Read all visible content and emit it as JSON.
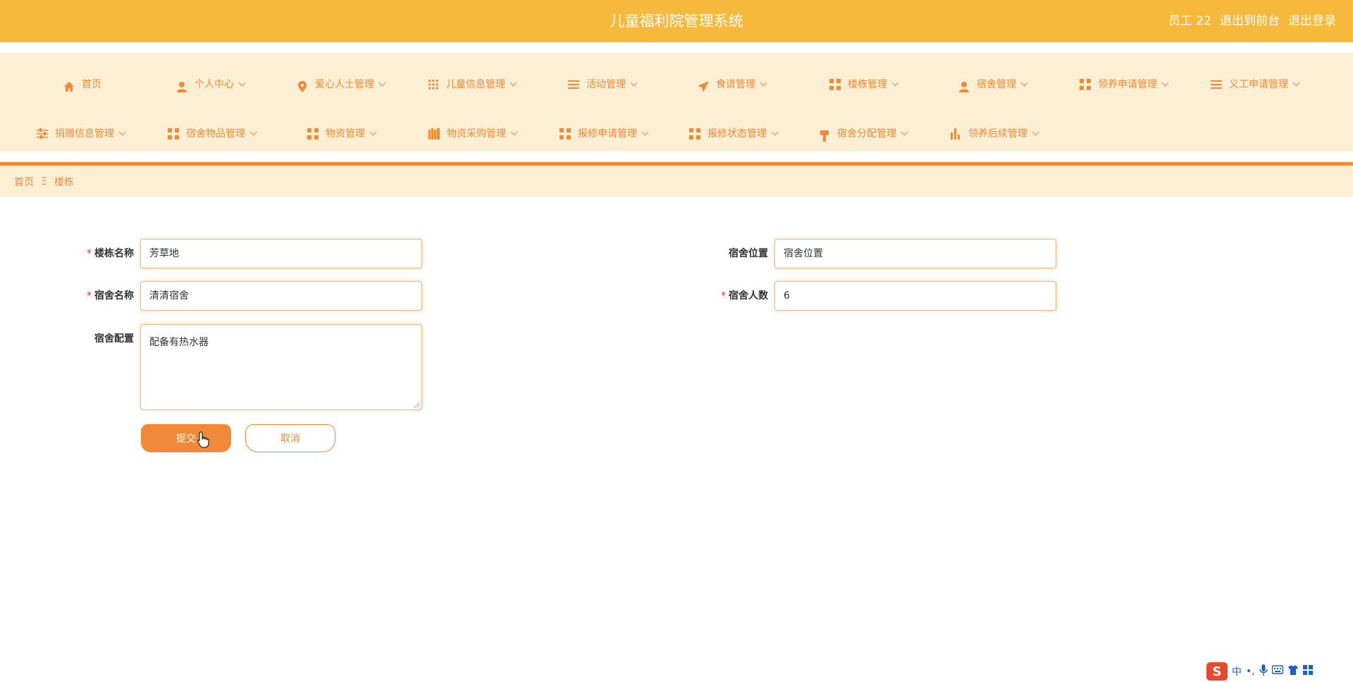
{
  "header": {
    "title": "儿童福利院管理系统",
    "user": "员工 22",
    "to_front": "退出到前台",
    "logout": "退出登录"
  },
  "nav": {
    "row1": [
      {
        "label": "首页",
        "icon": "home-icon"
      },
      {
        "label": "个人中心",
        "icon": "user-icon"
      },
      {
        "label": "爱心人士管理",
        "icon": "location-icon"
      },
      {
        "label": "儿童信息管理",
        "icon": "grid-dots-icon"
      },
      {
        "label": "活动管理",
        "icon": "list-icon"
      },
      {
        "label": "食谱管理",
        "icon": "send-icon"
      },
      {
        "label": "楼栋管理",
        "icon": "grid-icon"
      },
      {
        "label": "宿舍管理",
        "icon": "user-icon"
      },
      {
        "label": "领养申请管理",
        "icon": "grid-icon"
      },
      {
        "label": "义工申请管理",
        "icon": "list-icon"
      }
    ],
    "row2": [
      {
        "label": "捐赠信息管理",
        "icon": "sliders-icon"
      },
      {
        "label": "宿舍物品管理",
        "icon": "grid-icon"
      },
      {
        "label": "物资管理",
        "icon": "grid-icon"
      },
      {
        "label": "物资采购管理",
        "icon": "columns-icon"
      },
      {
        "label": "报修申请管理",
        "icon": "grid-icon"
      },
      {
        "label": "报修状态管理",
        "icon": "grid-icon"
      },
      {
        "label": "宿舍分配管理",
        "icon": "brush-icon"
      },
      {
        "label": "领养后续管理",
        "icon": "bar-chart-icon"
      }
    ]
  },
  "breadcrumb": {
    "home": "首页",
    "separator": "Ξ",
    "current": "楼栋"
  },
  "form": {
    "building_name": {
      "label": "楼栋名称",
      "value": "芳草地",
      "required": "*"
    },
    "dorm_location": {
      "label": "宿舍位置",
      "value": "宿舍位置"
    },
    "dorm_name": {
      "label": "宿舍名称",
      "value": "清清宿舍",
      "required": "*"
    },
    "dorm_capacity": {
      "label": "宿舍人数",
      "value": "6",
      "required": "*"
    },
    "dorm_config": {
      "label": "宿舍配置",
      "value": "配备有热水器"
    },
    "submit_label": "提交",
    "cancel_label": "取消"
  },
  "ime": {
    "logo": "S",
    "mode": "中",
    "punct": "•,"
  },
  "colors": {
    "header_bg": "#f7b93b",
    "nav_bg": "#fdefd4",
    "accent": "#ee8a3a"
  }
}
